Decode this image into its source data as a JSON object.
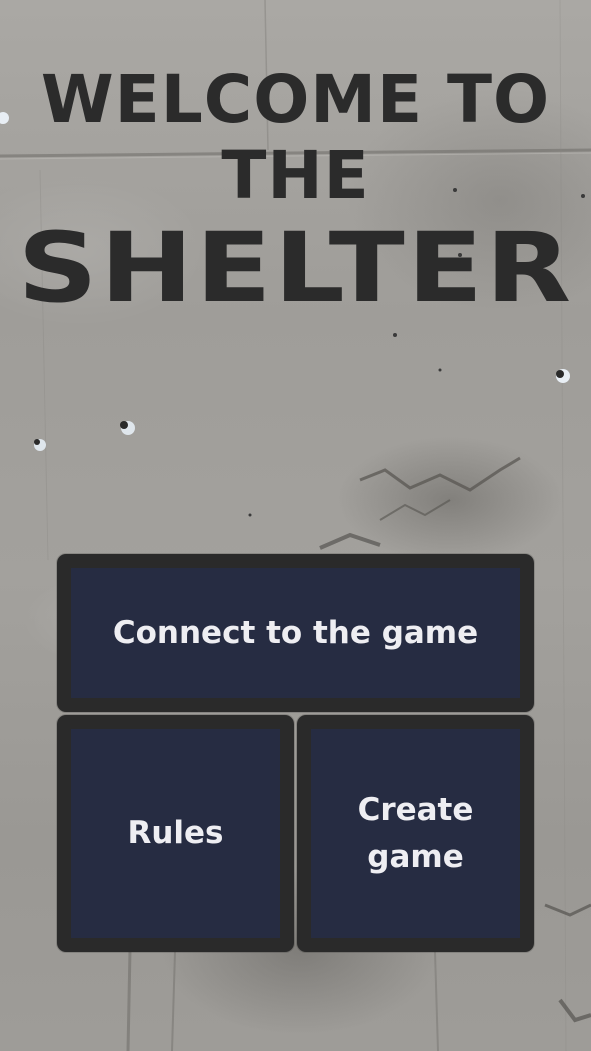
{
  "title": {
    "line1": "WELCOME TO",
    "line2": "THE",
    "line3": "SHELTER"
  },
  "menu": {
    "connect_label": "Connect to the game",
    "rules_label": "Rules",
    "create_label": "Create game"
  },
  "colors": {
    "title_text": "#2b2b2b",
    "button_fill": "#262c42",
    "button_border": "#2a2a2a",
    "button_text": "#eeeef2",
    "background": "#a19f9b"
  }
}
